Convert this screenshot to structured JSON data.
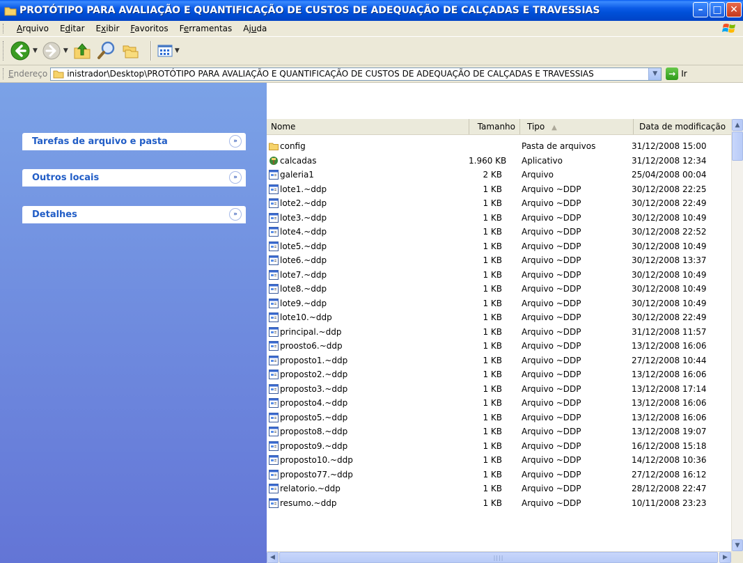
{
  "window": {
    "title": "PROTÓTIPO PARA  AVALIAÇÃO E QUANTIFICAÇÃO DE CUSTOS DE ADEQUAÇÃO DE CALÇADAS E TRAVESSIAS"
  },
  "menu": [
    {
      "pre": "",
      "u": "A",
      "post": "rquivo"
    },
    {
      "pre": "E",
      "u": "d",
      "post": "itar"
    },
    {
      "pre": "E",
      "u": "x",
      "post": "ibir"
    },
    {
      "pre": "",
      "u": "F",
      "post": "avoritos"
    },
    {
      "pre": "F",
      "u": "e",
      "post": "rramentas"
    },
    {
      "pre": "Aj",
      "u": "u",
      "post": "da"
    }
  ],
  "address": {
    "label_u": "E",
    "label_rest": "ndereço",
    "path": "inistrador\\Desktop\\PROTÓTIPO PARA  AVALIAÇÃO E QUANTIFICAÇÃO DE CUSTOS DE ADEQUAÇÃO DE CALÇADAS E TRAVESSIAS",
    "go_label": "Ir"
  },
  "tasks": [
    {
      "label": "Tarefas de arquivo e pasta"
    },
    {
      "label": "Outros locais"
    },
    {
      "label": "Detalhes"
    }
  ],
  "columns": {
    "name": "Nome",
    "size": "Tamanho",
    "type": "Tipo",
    "date": "Data de modificação"
  },
  "files": [
    {
      "name": "config",
      "size": "",
      "type": "Pasta de arquivos",
      "date": "31/12/2008 15:00",
      "icon": "folder"
    },
    {
      "name": "calcadas",
      "size": "1.960 KB",
      "type": "Aplicativo",
      "date": "31/12/2008 12:34",
      "icon": "app"
    },
    {
      "name": "galeria1",
      "size": "2 KB",
      "type": "Arquivo",
      "date": "25/04/2008 00:04",
      "icon": "file"
    },
    {
      "name": "lote1.~ddp",
      "size": "1 KB",
      "type": "Arquivo ~DDP",
      "date": "30/12/2008 22:25",
      "icon": "file"
    },
    {
      "name": "lote2.~ddp",
      "size": "1 KB",
      "type": "Arquivo ~DDP",
      "date": "30/12/2008 22:49",
      "icon": "file"
    },
    {
      "name": "lote3.~ddp",
      "size": "1 KB",
      "type": "Arquivo ~DDP",
      "date": "30/12/2008 10:49",
      "icon": "file"
    },
    {
      "name": "lote4.~ddp",
      "size": "1 KB",
      "type": "Arquivo ~DDP",
      "date": "30/12/2008 22:52",
      "icon": "file"
    },
    {
      "name": "lote5.~ddp",
      "size": "1 KB",
      "type": "Arquivo ~DDP",
      "date": "30/12/2008 10:49",
      "icon": "file"
    },
    {
      "name": "lote6.~ddp",
      "size": "1 KB",
      "type": "Arquivo ~DDP",
      "date": "30/12/2008 13:37",
      "icon": "file"
    },
    {
      "name": "lote7.~ddp",
      "size": "1 KB",
      "type": "Arquivo ~DDP",
      "date": "30/12/2008 10:49",
      "icon": "file"
    },
    {
      "name": "lote8.~ddp",
      "size": "1 KB",
      "type": "Arquivo ~DDP",
      "date": "30/12/2008 10:49",
      "icon": "file"
    },
    {
      "name": "lote9.~ddp",
      "size": "1 KB",
      "type": "Arquivo ~DDP",
      "date": "30/12/2008 10:49",
      "icon": "file"
    },
    {
      "name": "lote10.~ddp",
      "size": "1 KB",
      "type": "Arquivo ~DDP",
      "date": "30/12/2008 22:49",
      "icon": "file"
    },
    {
      "name": "principal.~ddp",
      "size": "1 KB",
      "type": "Arquivo ~DDP",
      "date": "31/12/2008 11:57",
      "icon": "file"
    },
    {
      "name": "proosto6.~ddp",
      "size": "1 KB",
      "type": "Arquivo ~DDP",
      "date": "13/12/2008 16:06",
      "icon": "file"
    },
    {
      "name": "proposto1.~ddp",
      "size": "1 KB",
      "type": "Arquivo ~DDP",
      "date": "27/12/2008 10:44",
      "icon": "file"
    },
    {
      "name": "proposto2.~ddp",
      "size": "1 KB",
      "type": "Arquivo ~DDP",
      "date": "13/12/2008 16:06",
      "icon": "file"
    },
    {
      "name": "proposto3.~ddp",
      "size": "1 KB",
      "type": "Arquivo ~DDP",
      "date": "13/12/2008 17:14",
      "icon": "file"
    },
    {
      "name": "proposto4.~ddp",
      "size": "1 KB",
      "type": "Arquivo ~DDP",
      "date": "13/12/2008 16:06",
      "icon": "file"
    },
    {
      "name": "proposto5.~ddp",
      "size": "1 KB",
      "type": "Arquivo ~DDP",
      "date": "13/12/2008 16:06",
      "icon": "file"
    },
    {
      "name": "proposto8.~ddp",
      "size": "1 KB",
      "type": "Arquivo ~DDP",
      "date": "13/12/2008 19:07",
      "icon": "file"
    },
    {
      "name": "proposto9.~ddp",
      "size": "1 KB",
      "type": "Arquivo ~DDP",
      "date": "16/12/2008 15:18",
      "icon": "file"
    },
    {
      "name": "proposto10.~ddp",
      "size": "1 KB",
      "type": "Arquivo ~DDP",
      "date": "14/12/2008 10:36",
      "icon": "file"
    },
    {
      "name": "proposto77.~ddp",
      "size": "1 KB",
      "type": "Arquivo ~DDP",
      "date": "27/12/2008 16:12",
      "icon": "file"
    },
    {
      "name": "relatorio.~ddp",
      "size": "1 KB",
      "type": "Arquivo ~DDP",
      "date": "28/12/2008 22:47",
      "icon": "file"
    },
    {
      "name": "resumo.~ddp",
      "size": "1 KB",
      "type": "Arquivo ~DDP",
      "date": "10/11/2008 23:23",
      "icon": "file"
    }
  ],
  "colors": {
    "title_blue": "#0054e3",
    "task_pane": "#7ba2e7",
    "task_link": "#215dc6",
    "chrome": "#ece9d8"
  }
}
